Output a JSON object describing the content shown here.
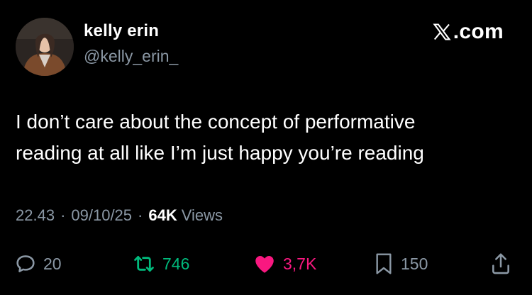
{
  "author": {
    "name": "kelly erin",
    "handle": "@kelly_erin_"
  },
  "brand": {
    "icon": "x-logo-icon",
    "text": ".com"
  },
  "tweet": {
    "line1": "I don’t care about the concept of performative",
    "line2": "reading at all like I’m just happy you’re reading"
  },
  "meta": {
    "time": "22.43",
    "separator": "·",
    "date": "09/10/25",
    "views_count": "64K",
    "views_label": "Views"
  },
  "actions": {
    "replies": "20",
    "retweets": "746",
    "likes": "3,7K",
    "bookmarks": "150"
  },
  "colors": {
    "background": "#000000",
    "text_primary": "#ffffff",
    "text_secondary": "#8b98a5",
    "retweet_green": "#00ba7c",
    "like_pink": "#f91880"
  }
}
